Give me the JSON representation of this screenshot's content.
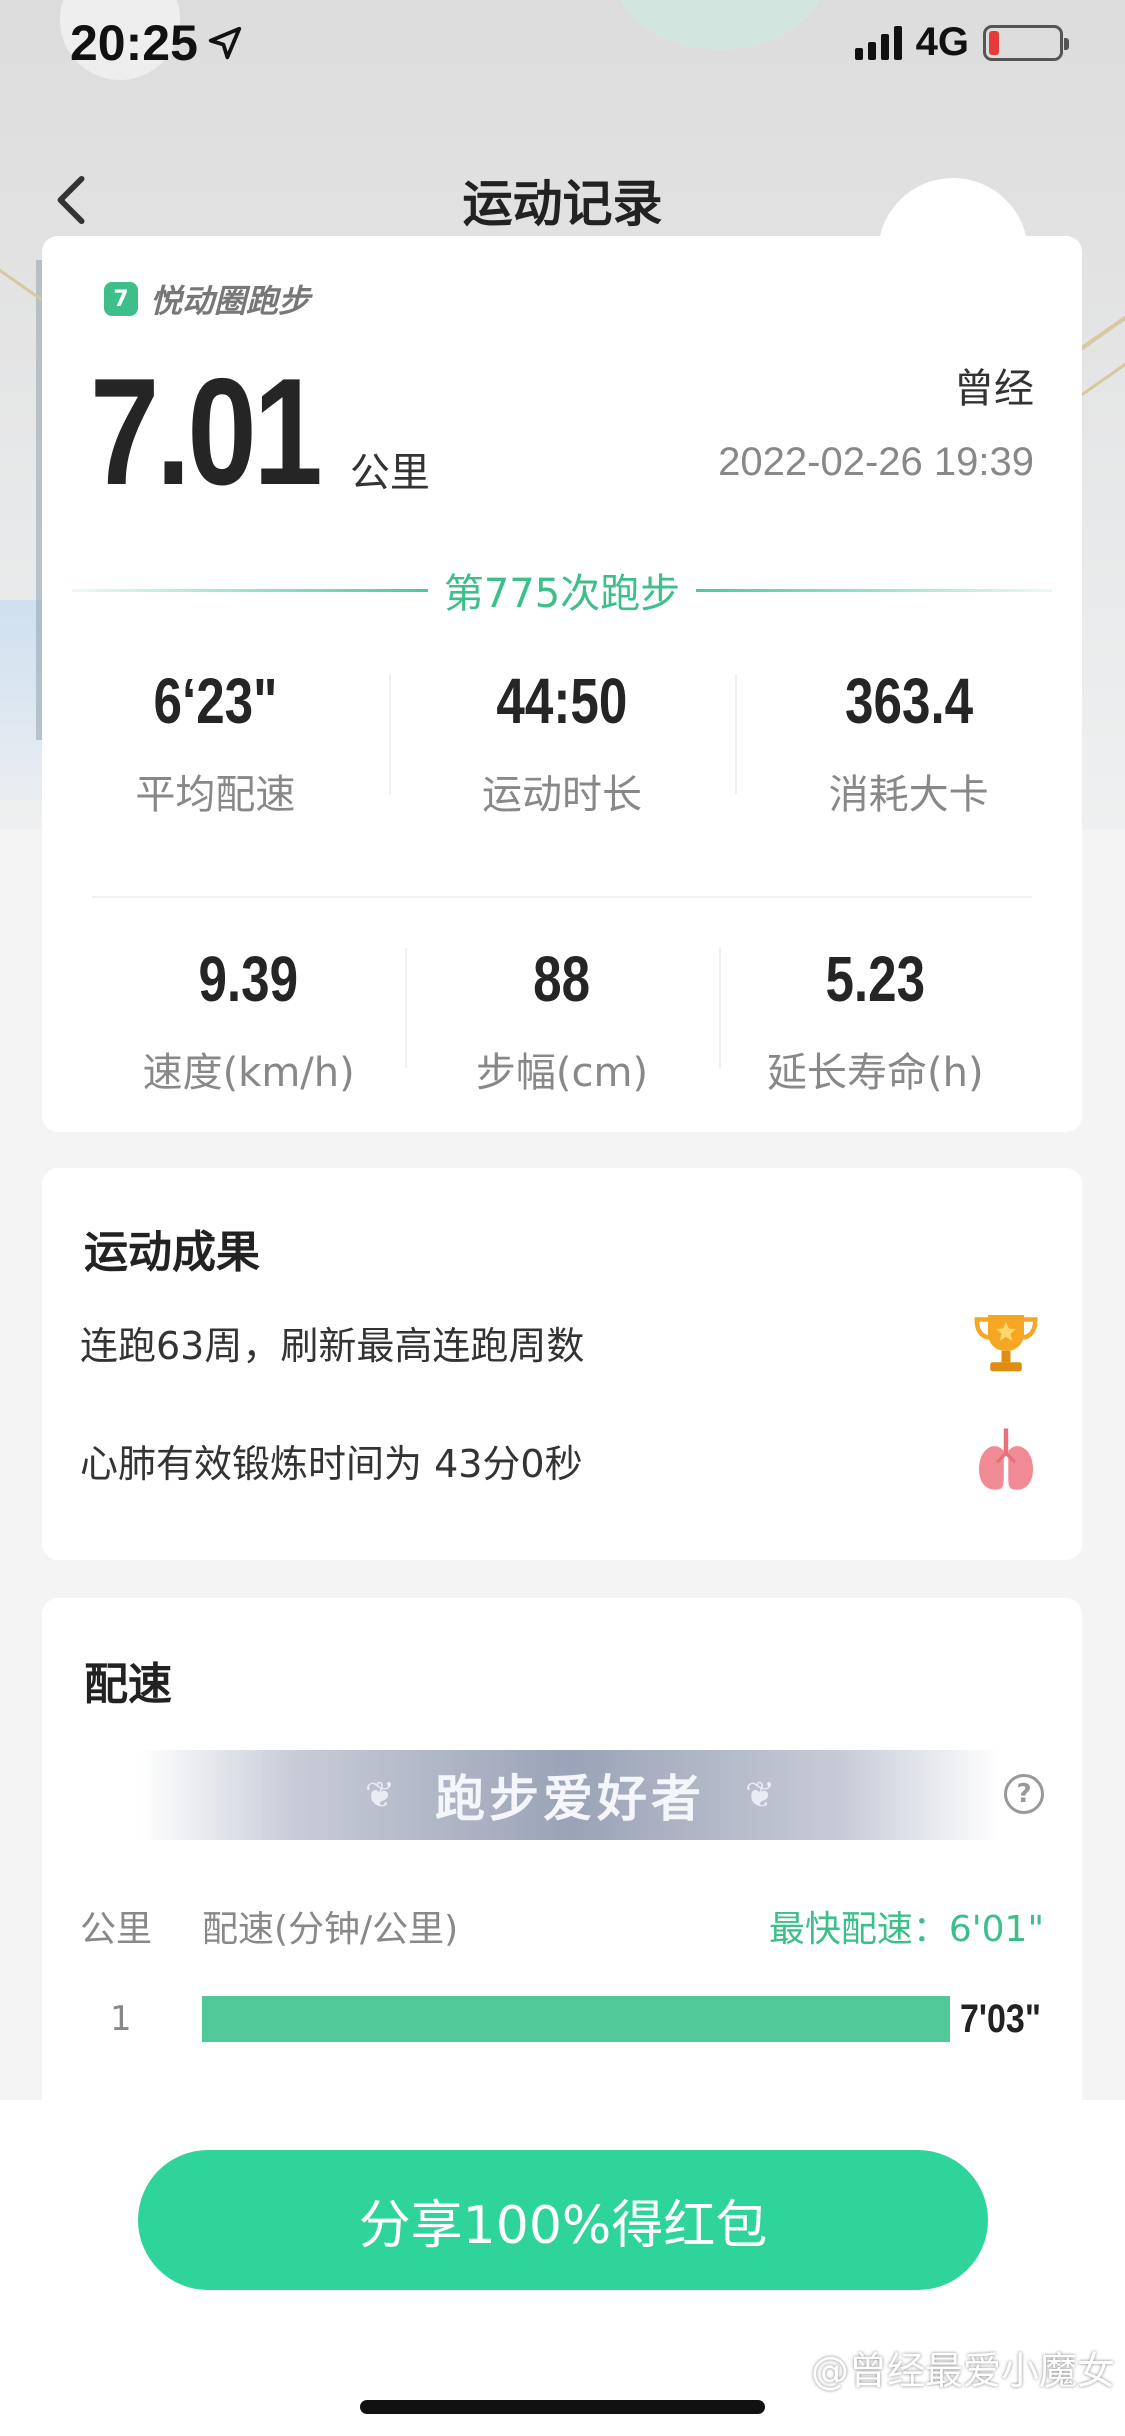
{
  "status_bar": {
    "time": "20:25",
    "network": "4G"
  },
  "nav": {
    "title": "运动记录"
  },
  "summary": {
    "brand": "悦动圈跑步",
    "distance": "7.01",
    "distance_unit": "公里",
    "user_name": "曾经",
    "date": "2022-02-26 19:39",
    "run_count": "第775次跑步",
    "stats": [
      {
        "value": "6‘23\"",
        "label": "平均配速"
      },
      {
        "value": "44:50",
        "label": "运动时长"
      },
      {
        "value": "363.4",
        "label": "消耗大卡"
      },
      {
        "value": "9.39",
        "label": "速度(km/h)"
      },
      {
        "value": "88",
        "label": "步幅(cm)"
      },
      {
        "value": "5.23",
        "label": "延长寿命(h)"
      }
    ]
  },
  "achievements": {
    "title": "运动成果",
    "items": [
      {
        "text": "连跑63周，刷新最高连跑周数",
        "icon": "trophy-icon"
      },
      {
        "text": "心肺有效锻炼时间为 43分0秒",
        "icon": "lungs-icon"
      }
    ]
  },
  "pace": {
    "title": "配速",
    "level": "跑步爱好者",
    "col_km": "公里",
    "col_pace": "配速(分钟/公里)",
    "fastest": "最快配速：6'01\"",
    "rows": [
      {
        "km": "1",
        "pace": "7'03\"",
        "fill": 1.0
      }
    ]
  },
  "bottom": {
    "share_label": "分享100%得红包"
  },
  "watermark": "@曾经最爱小魔女",
  "colors": {
    "accent": "#2fd49a",
    "bar": "#50c898",
    "green_text": "#3cbf88"
  }
}
